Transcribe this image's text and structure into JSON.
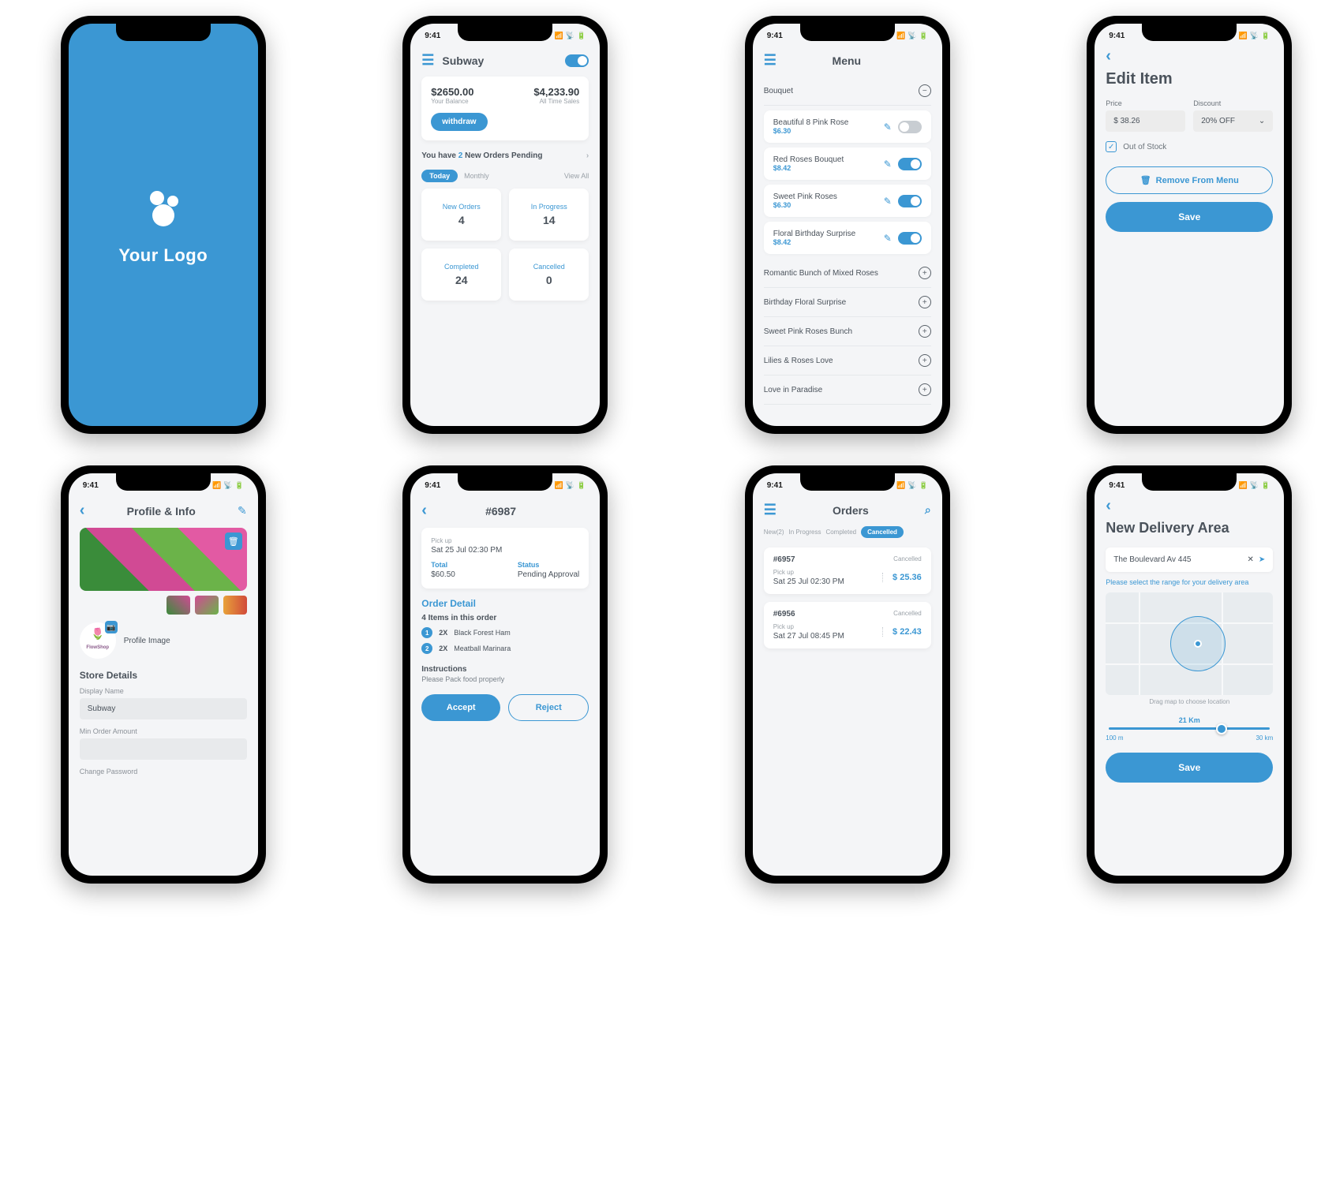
{
  "status": {
    "time": "9:41"
  },
  "screen1": {
    "logo_text": "Your Logo"
  },
  "screen2": {
    "title": "Subway",
    "balance": {
      "value": "$2650.00",
      "label": "Your Balance"
    },
    "sales": {
      "value": "$4,233.90",
      "label": "All Time Sales"
    },
    "withdraw": "withdraw",
    "pending_pre": "You have ",
    "pending_num": "2",
    "pending_post": " New Orders Pending",
    "tabs": {
      "today": "Today",
      "monthly": "Monthly",
      "viewall": "View All"
    },
    "stats": [
      {
        "label": "New Orders",
        "value": "4"
      },
      {
        "label": "In Progress",
        "value": "14"
      },
      {
        "label": "Completed",
        "value": "24"
      },
      {
        "label": "Cancelled",
        "value": "0"
      }
    ]
  },
  "screen3": {
    "title": "Menu",
    "section": "Bouquet",
    "items": [
      {
        "name": "Beautiful 8 Pink Rose",
        "price": "$6.30",
        "toggle": false
      },
      {
        "name": "Red Roses Bouquet",
        "price": "$8.42",
        "toggle": true
      },
      {
        "name": "Sweet Pink Roses",
        "price": "$6.30",
        "toggle": true
      },
      {
        "name": "Floral Birthday Surprise",
        "price": "$8.42",
        "toggle": true
      }
    ],
    "more": [
      "Romantic Bunch of Mixed Roses",
      "Birthday Floral Surprise",
      "Sweet Pink Roses Bunch",
      "Lilies & Roses Love",
      "Love in Paradise"
    ]
  },
  "screen4": {
    "title": "Edit Item",
    "price_lbl": "Price",
    "price_val": "$ 38.26",
    "discount_lbl": "Discount",
    "discount_val": "20% OFF",
    "out_of_stock": "Out of Stock",
    "remove": "Remove From Menu",
    "save": "Save"
  },
  "screen5": {
    "title": "Profile & Info",
    "profile_image": "Profile Image",
    "shop_name": "FlowShop",
    "store_details": "Store Details",
    "display_name_lbl": "Display Name",
    "display_name_val": "Subway",
    "min_order_lbl": "Min Order Amount",
    "change_pwd": "Change Password"
  },
  "screen6": {
    "title": "#6987",
    "pickup_lbl": "Pick up",
    "pickup_val": "Sat 25 Jul 02:30 PM",
    "total_lbl": "Total",
    "total_val": "$60.50",
    "status_lbl": "Status",
    "status_val": "Pending Approval",
    "detail_head": "Order Detail",
    "detail_sub": "4 Items in this order",
    "items": [
      {
        "qty": "2X",
        "name": "Black Forest Ham"
      },
      {
        "qty": "2X",
        "name": "Meatball Marinara"
      }
    ],
    "instr_lbl": "Instructions",
    "instr_val": "Please Pack food properly",
    "accept": "Accept",
    "reject": "Reject"
  },
  "screen7": {
    "title": "Orders",
    "tabs": {
      "new": "New(2)",
      "progress": "In Progress",
      "completed": "Completed",
      "cancelled": "Cancelled"
    },
    "orders": [
      {
        "id": "#6957",
        "status": "Cancelled",
        "pickup_lbl": "Pick up",
        "pickup_val": "Sat 25 Jul 02:30 PM",
        "price": "$ 25.36"
      },
      {
        "id": "#6956",
        "status": "Cancelled",
        "pickup_lbl": "Pick up",
        "pickup_val": "Sat 27 Jul 08:45 PM",
        "price": "$ 22.43"
      }
    ]
  },
  "screen8": {
    "title": "New Delivery Area",
    "address": "The Boulevard Av 445",
    "help": "Please select the range for your delivery area",
    "map_hint": "Drag map to choose location",
    "slider_val": "21 Km",
    "slider_min": "100 m",
    "slider_max": "30 km",
    "save": "Save"
  }
}
